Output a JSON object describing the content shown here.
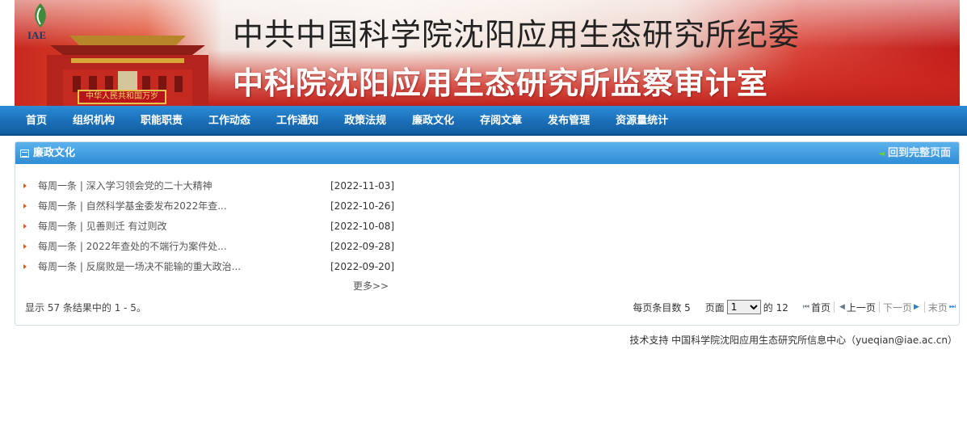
{
  "banner": {
    "logo_text": "IAE",
    "title_line1": "中共中国科学院沈阳应用生态研究所纪委",
    "title_line2": "中科院沈阳应用生态研究所监察审计室",
    "plaque_text": "中华人民共和国万岁"
  },
  "nav": {
    "items": [
      "首页",
      "组织机构",
      "职能职责",
      "工作动态",
      "工作通知",
      "政策法规",
      "廉政文化",
      "存阅文章",
      "发布管理",
      "资源量统计"
    ]
  },
  "panel": {
    "title": "廉政文化",
    "back_label": "回到完整页面",
    "more_label": "更多>>",
    "items": [
      {
        "title": "每周一条 | 深入学习领会党的二十大精神",
        "date": "[2022-11-03]"
      },
      {
        "title": "每周一条 | 自然科学基金委发布2022年查...",
        "date": "[2022-10-26]"
      },
      {
        "title": "每周一条 | 见善则迁 有过则改",
        "date": "[2022-10-08]"
      },
      {
        "title": "每周一条 | 2022年查处的不端行为案件处...",
        "date": "[2022-09-28]"
      },
      {
        "title": "每周一条 | 反腐败是一场决不能输的重大政治...",
        "date": "[2022-09-20]"
      }
    ],
    "summary": "显示 57 条结果中的 1 - 5。"
  },
  "pager": {
    "per_page_label": "每页条目数 5",
    "page_label": "页面",
    "page_value": "1",
    "of_label": "的 12",
    "first_label": "首页",
    "prev_label": "上一页",
    "next_label": "下一页",
    "last_label": "末页"
  },
  "footer": {
    "text": "技术支持 中国科学院沈阳应用生态研究所信息中心（yueqian@iae.ac.cn）"
  }
}
